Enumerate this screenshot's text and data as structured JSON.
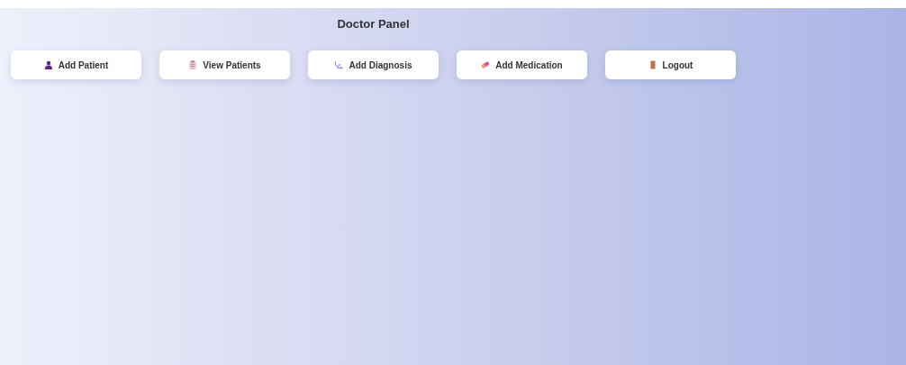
{
  "title": "Doctor Panel",
  "buttons": [
    {
      "label": "Add Patient",
      "kind": "person"
    },
    {
      "label": "View Patients",
      "kind": "clipboard"
    },
    {
      "label": "Add Diagnosis",
      "kind": "stethoscope"
    },
    {
      "label": "Add Medication",
      "kind": "pill"
    },
    {
      "label": "Logout",
      "kind": "door"
    }
  ]
}
